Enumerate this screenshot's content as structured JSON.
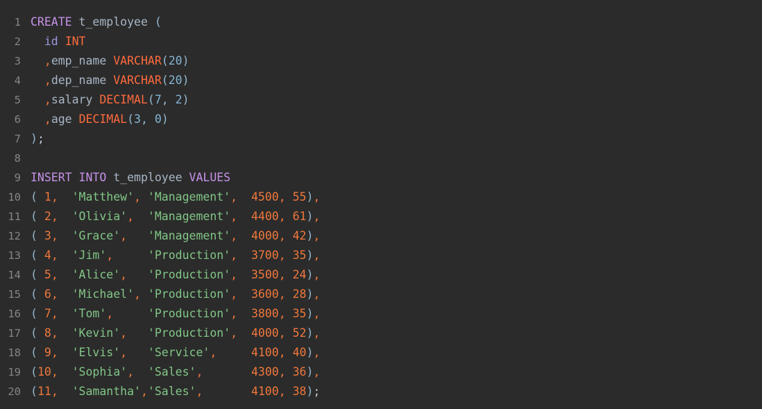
{
  "editor": {
    "language": "sql",
    "background": "#2b2b2b",
    "gutter_color": "#868686",
    "total_lines": 20,
    "colors": {
      "keyword": "#c792ea",
      "datatype": "#ff6b3d",
      "number": "#f0783c",
      "paren_number": "#83b5d4",
      "string": "#82c686",
      "identifier": "#a9b7c6",
      "column_name": "#9a9ae0",
      "paren": "#94b8cf",
      "comma": "#f0783c"
    }
  },
  "line_numbers": [
    "1",
    "2",
    "3",
    "4",
    "5",
    "6",
    "7",
    "8",
    "9",
    "10",
    "11",
    "12",
    "13",
    "14",
    "15",
    "16",
    "17",
    "18",
    "19",
    "20"
  ],
  "code": {
    "l1": {
      "kw": "CREATE",
      "sp1": " ",
      "table": "t_employee",
      "sp2": " ",
      "paren": "("
    },
    "l2": {
      "indent": "  ",
      "col": "id",
      "sp": " ",
      "type": "INT"
    },
    "l3": {
      "indent": "  ",
      "comma": ",",
      "col": "emp_name",
      "sp": " ",
      "type": "VARCHAR",
      "open": "(",
      "len": "20",
      "close": ")"
    },
    "l4": {
      "indent": "  ",
      "comma": ",",
      "col": "dep_name",
      "sp": " ",
      "type": "VARCHAR",
      "open": "(",
      "len": "20",
      "close": ")"
    },
    "l5": {
      "indent": "  ",
      "comma": ",",
      "col": "salary",
      "sp": " ",
      "type": "DECIMAL",
      "open": "(",
      "p": "7",
      "sep": ", ",
      "s": "2",
      "close": ")"
    },
    "l6": {
      "indent": "  ",
      "comma": ",",
      "col": "age",
      "sp": " ",
      "type": "DECIMAL",
      "open": "(",
      "p": "3",
      "sep": ", ",
      "s": "0",
      "close": ")"
    },
    "l7": {
      "close": ")",
      "semi": ";"
    },
    "l8": {
      "empty": ""
    },
    "l9": {
      "kw1": "INSERT",
      "sp1": " ",
      "kw2": "INTO",
      "sp2": " ",
      "table": "t_employee",
      "sp3": " ",
      "kw3": "VALUES"
    }
  },
  "insert_statement": {
    "keywords": [
      "INSERT",
      "INTO",
      "VALUES"
    ],
    "table": "t_employee",
    "columns": [
      "id",
      "emp_name",
      "dep_name",
      "salary",
      "age"
    ],
    "rows": [
      {
        "line": "10",
        "open": "(",
        "id": " 1",
        "c1": ",  ",
        "emp_name": "'Matthew'",
        "c2": ", ",
        "dep_name": "'Management'",
        "c3": ",  ",
        "salary": "4500",
        "c4": ", ",
        "age": "55",
        "close": ")",
        "end": ","
      },
      {
        "line": "11",
        "open": "(",
        "id": " 2",
        "c1": ",  ",
        "emp_name": "'Olivia'",
        "c2": ",  ",
        "dep_name": "'Management'",
        "c3": ",  ",
        "salary": "4400",
        "c4": ", ",
        "age": "61",
        "close": ")",
        "end": ","
      },
      {
        "line": "12",
        "open": "(",
        "id": " 3",
        "c1": ",  ",
        "emp_name": "'Grace'",
        "c2": ",   ",
        "dep_name": "'Management'",
        "c3": ",  ",
        "salary": "4000",
        "c4": ", ",
        "age": "42",
        "close": ")",
        "end": ","
      },
      {
        "line": "13",
        "open": "(",
        "id": " 4",
        "c1": ",  ",
        "emp_name": "'Jim'",
        "c2": ",     ",
        "dep_name": "'Production'",
        "c3": ",  ",
        "salary": "3700",
        "c4": ", ",
        "age": "35",
        "close": ")",
        "end": ","
      },
      {
        "line": "14",
        "open": "(",
        "id": " 5",
        "c1": ",  ",
        "emp_name": "'Alice'",
        "c2": ",   ",
        "dep_name": "'Production'",
        "c3": ",  ",
        "salary": "3500",
        "c4": ", ",
        "age": "24",
        "close": ")",
        "end": ","
      },
      {
        "line": "15",
        "open": "(",
        "id": " 6",
        "c1": ",  ",
        "emp_name": "'Michael'",
        "c2": ", ",
        "dep_name": "'Production'",
        "c3": ",  ",
        "salary": "3600",
        "c4": ", ",
        "age": "28",
        "close": ")",
        "end": ","
      },
      {
        "line": "16",
        "open": "(",
        "id": " 7",
        "c1": ",  ",
        "emp_name": "'Tom'",
        "c2": ",     ",
        "dep_name": "'Production'",
        "c3": ",  ",
        "salary": "3800",
        "c4": ", ",
        "age": "35",
        "close": ")",
        "end": ","
      },
      {
        "line": "17",
        "open": "(",
        "id": " 8",
        "c1": ",  ",
        "emp_name": "'Kevin'",
        "c2": ",   ",
        "dep_name": "'Production'",
        "c3": ",  ",
        "salary": "4000",
        "c4": ", ",
        "age": "52",
        "close": ")",
        "end": ","
      },
      {
        "line": "18",
        "open": "(",
        "id": " 9",
        "c1": ",  ",
        "emp_name": "'Elvis'",
        "c2": ",   ",
        "dep_name": "'Service'",
        "c3": ",     ",
        "salary": "4100",
        "c4": ", ",
        "age": "40",
        "close": ")",
        "end": ","
      },
      {
        "line": "19",
        "open": "(",
        "id": "10",
        "c1": ",  ",
        "emp_name": "'Sophia'",
        "c2": ",  ",
        "dep_name": "'Sales'",
        "c3": ",       ",
        "salary": "4300",
        "c4": ", ",
        "age": "36",
        "close": ")",
        "end": ","
      },
      {
        "line": "20",
        "open": "(",
        "id": "11",
        "c1": ",  ",
        "emp_name": "'Samantha'",
        "c2": ",",
        "dep_name": "'Sales'",
        "c3": ",       ",
        "salary": "4100",
        "c4": ", ",
        "age": "38",
        "close": ")",
        "end": ";"
      }
    ]
  },
  "table_data": {
    "type": "table",
    "title": "t_employee",
    "columns": [
      "id",
      "emp_name",
      "dep_name",
      "salary",
      "age"
    ],
    "column_types": [
      "INT",
      "VARCHAR(20)",
      "VARCHAR(20)",
      "DECIMAL(7, 2)",
      "DECIMAL(3, 0)"
    ],
    "values": [
      [
        1,
        "Matthew",
        "Management",
        4500,
        55
      ],
      [
        2,
        "Olivia",
        "Management",
        4400,
        61
      ],
      [
        3,
        "Grace",
        "Management",
        4000,
        42
      ],
      [
        4,
        "Jim",
        "Production",
        3700,
        35
      ],
      [
        5,
        "Alice",
        "Production",
        3500,
        24
      ],
      [
        6,
        "Michael",
        "Production",
        3600,
        28
      ],
      [
        7,
        "Tom",
        "Production",
        3800,
        35
      ],
      [
        8,
        "Kevin",
        "Production",
        4000,
        52
      ],
      [
        9,
        "Elvis",
        "Service",
        4100,
        40
      ],
      [
        10,
        "Sophia",
        "Sales",
        4300,
        36
      ],
      [
        11,
        "Samantha",
        "Sales",
        4100,
        38
      ]
    ]
  }
}
